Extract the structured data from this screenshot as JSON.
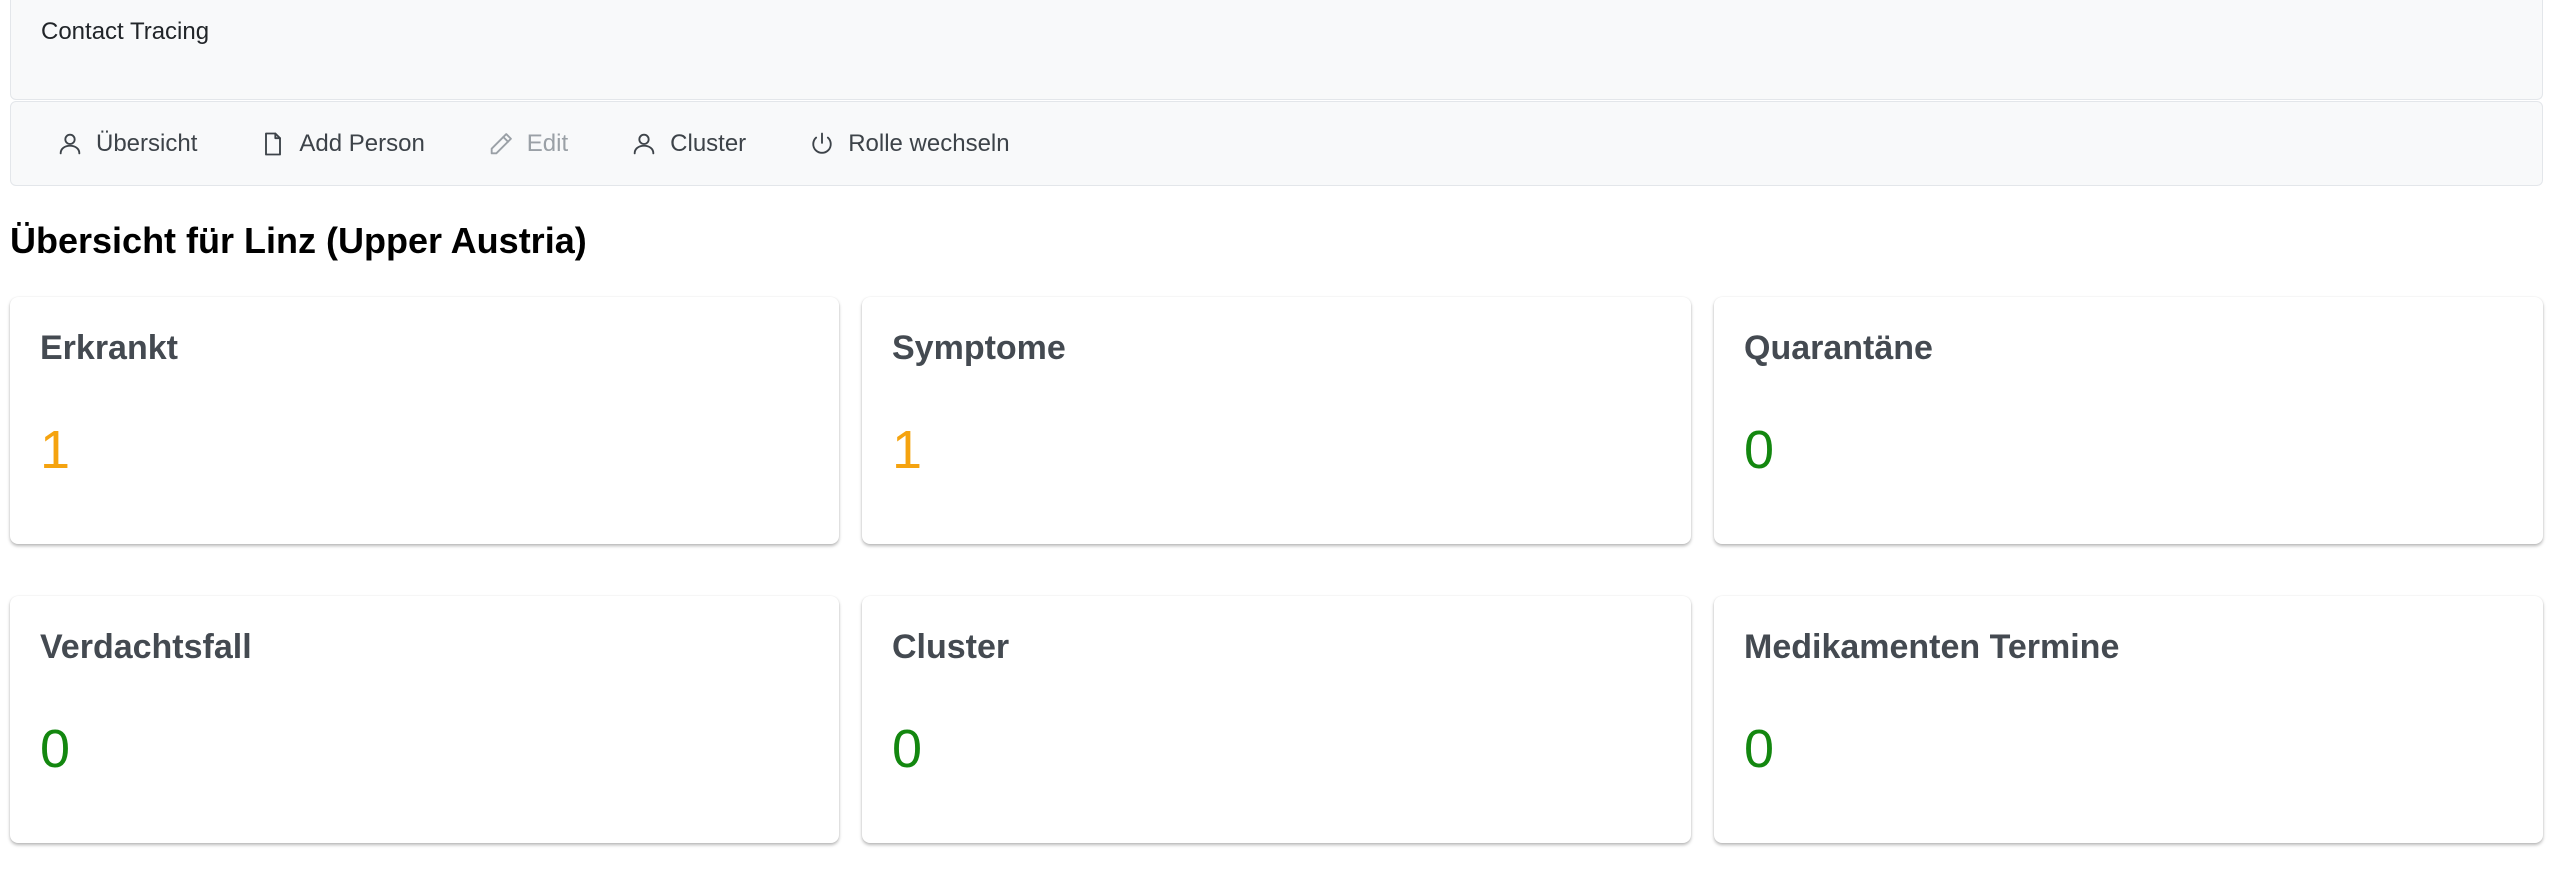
{
  "header": {
    "title": "Contact Tracing"
  },
  "nav": {
    "items": [
      {
        "label": "Übersicht",
        "icon": "person-icon"
      },
      {
        "label": "Add Person",
        "icon": "document-icon"
      },
      {
        "label": "Edit",
        "icon": "pencil-icon",
        "disabled": true
      },
      {
        "label": "Cluster",
        "icon": "person-icon"
      },
      {
        "label": "Rolle wechseln",
        "icon": "power-icon"
      }
    ]
  },
  "main": {
    "title": "Übersicht für Linz (Upper Austria)",
    "cards": [
      {
        "title": "Erkrankt",
        "value": "1",
        "color": "#f5a30f"
      },
      {
        "title": "Symptome",
        "value": "1",
        "color": "#f5a30f"
      },
      {
        "title": "Quarantäne",
        "value": "0",
        "color": "#13870f"
      },
      {
        "title": "Verdachtsfall",
        "value": "0",
        "color": "#13870f"
      },
      {
        "title": "Cluster",
        "value": "0",
        "color": "#13870f"
      },
      {
        "title": "Medikamenten Termine",
        "value": "0",
        "color": "#13870f"
      }
    ]
  }
}
